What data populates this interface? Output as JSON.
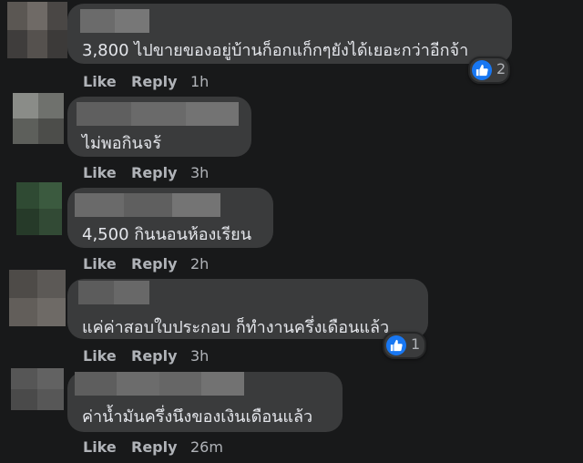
{
  "comments": [
    {
      "text": "3,800 ไปขายของอยู่บ้านก็อกแก็กๆยังได้เยอะกว่าอีกจ้า",
      "like_label": "Like",
      "reply_label": "Reply",
      "time": "1h",
      "reaction_count": "2"
    },
    {
      "text": "ไม่พอกินจร้",
      "like_label": "Like",
      "reply_label": "Reply",
      "time": "3h"
    },
    {
      "text": "4,500 กินนอนห้องเรียน",
      "like_label": "Like",
      "reply_label": "Reply",
      "time": "2h"
    },
    {
      "text": "แค่ค่าสอบใบประกอบ ก็ทำงานครึ่งเดือนแล้ว",
      "like_label": "Like",
      "reply_label": "Reply",
      "time": "3h",
      "reaction_count": "1"
    },
    {
      "text": "ค่าน้ำมันครึ่งนึงของเงินเดือนแล้ว",
      "like_label": "Like",
      "reply_label": "Reply",
      "time": "26m"
    }
  ],
  "icons": {
    "reaction": "like-thumbs-up-icon"
  },
  "colors": {
    "background": "#18191a",
    "bubble": "#3a3b3c",
    "text": "#e4e6eb",
    "secondary_text": "#b0b3b8",
    "like_blue": "#1877f2"
  }
}
